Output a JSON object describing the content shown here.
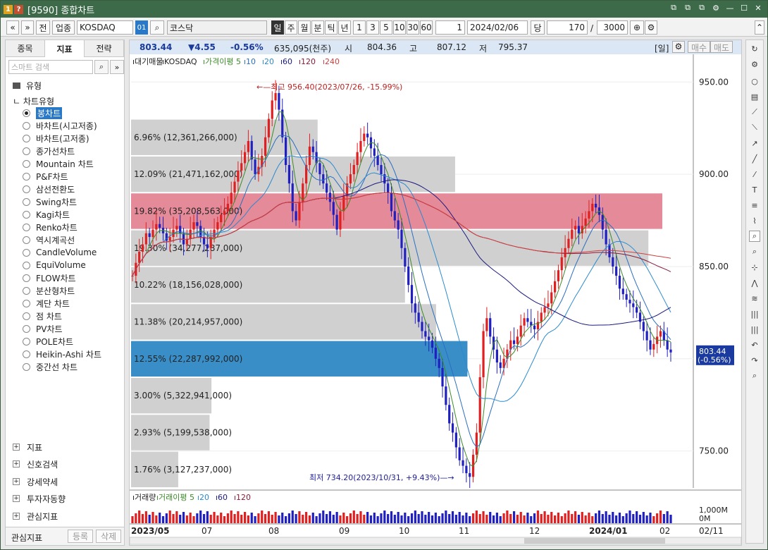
{
  "window": {
    "code_badge": "1",
    "help_badge": "?",
    "title": "[9590] 종합차트",
    "controls": [
      "⧉",
      "⧉",
      "⧉",
      "⚙",
      "—",
      "☐",
      "✕"
    ]
  },
  "toolbar": {
    "nav_prev": "«",
    "nav_menu": "»",
    "btn_prev_item": "전",
    "btn_sector": "업종",
    "code": "KOSDAQ",
    "code_badge": "01",
    "name": "코스닥",
    "period_buttons": [
      "일",
      "주",
      "월",
      "분",
      "틱",
      "년"
    ],
    "active_period": "일",
    "interval_buttons": [
      "1",
      "3",
      "5",
      "10",
      "30",
      "60"
    ],
    "interval_value": "1",
    "date": "2024/02/06",
    "date_btn": "당",
    "count": "170",
    "count_sep": "/",
    "max": "3000"
  },
  "left": {
    "tabs": [
      "종목",
      "지표",
      "전략"
    ],
    "active_tab": "지표",
    "search_placeholder": "스마트 검색",
    "category": "유형",
    "tree_root": "차트유형",
    "chart_types": [
      "봉차트",
      "바차트(시고저종)",
      "바차트(고저종)",
      "종가선차트",
      "Mountain 차트",
      "P&F차트",
      "삼선전환도",
      "Swing차트",
      "Kagi차트",
      "Renko차트",
      "역시계곡선",
      "CandleVolume",
      "EquiVolume",
      "FLOW차트",
      "분산형차트",
      "계단 차트",
      "점 차트",
      "PV차트",
      "POLE차트",
      "Heikin-Ashi 차트",
      "중간선 차트"
    ],
    "selected_type": "봉차트",
    "sections": [
      "지표",
      "신호검색",
      "강세약세",
      "투자자동향",
      "관심지표"
    ],
    "footer_label": "관심지표",
    "footer_register": "등록",
    "footer_delete": "삭제"
  },
  "infobar": {
    "price": "803.44",
    "change": "▼4.55",
    "pct": "-0.56%",
    "volume": "635,095(천주)",
    "open_lbl": "시",
    "open": "804.36",
    "high_lbl": "고",
    "high": "807.12",
    "low_lbl": "저",
    "low": "795.37",
    "period": "[일]",
    "buy": "매수",
    "sell": "매도"
  },
  "legend": {
    "items": [
      {
        "text": "대기매물",
        "color": "#222222"
      },
      {
        "text": "KOSDAQ",
        "color": "#222222"
      },
      {
        "text": "가격이평 5",
        "color": "#3d8a2a"
      },
      {
        "text": "10",
        "color": "#2a6fc0"
      },
      {
        "text": "20",
        "color": "#2a8ad0"
      },
      {
        "text": "60",
        "color": "#1a1a80"
      },
      {
        "text": "120",
        "color": "#8a1a3a"
      },
      {
        "text": "240",
        "color": "#d04040"
      }
    ]
  },
  "volume_legend": {
    "items": [
      {
        "text": "거래량",
        "color": "#222222"
      },
      {
        "text": "거래이평 5",
        "color": "#3d8a2a"
      },
      {
        "text": "20",
        "color": "#2a8ad0"
      },
      {
        "text": "60",
        "color": "#1a1a80"
      },
      {
        "text": "120",
        "color": "#8a1a3a"
      }
    ]
  },
  "annotations": {
    "high": "최고 956.40(2023/07/26, -15.99%)",
    "low": "최저 734.20(2023/10/31, +9.43%)"
  },
  "price_badge": {
    "price": "803.44",
    "pct": "(-0.56%)"
  },
  "axis_right": {
    "ticks": [
      "950.00",
      "900.00",
      "850.00",
      "800.00",
      "750.00"
    ],
    "vol_ticks": [
      "1,000M",
      "0M"
    ]
  },
  "axis_bottom": {
    "labels": [
      "2023/05",
      "07",
      "08",
      "09",
      "10",
      "11",
      "12",
      "2024/01",
      "02",
      "02/11"
    ]
  },
  "chart_data": {
    "type": "candlestick",
    "symbol": "KOSDAQ",
    "period": "daily",
    "ylim": [
      730,
      965
    ],
    "y_ticks": [
      750,
      800,
      850,
      900,
      950
    ],
    "volume_profile": [
      {
        "label": "6.96% (12,361,266,000)",
        "low": 910,
        "high": 930,
        "pct": 6.96,
        "color": "#d0d0d0"
      },
      {
        "label": "12.09% (21,471,162,000)",
        "low": 890,
        "high": 910,
        "pct": 12.09,
        "color": "#d0d0d0"
      },
      {
        "label": "19.82% (35,208,563,000)",
        "low": 870,
        "high": 890,
        "pct": 19.82,
        "color": "#e48a98"
      },
      {
        "label": "19.30% (34,277,287,000)",
        "low": 850,
        "high": 870,
        "pct": 19.3,
        "color": "#d0d0d0"
      },
      {
        "label": "10.22% (18,156,028,000)",
        "low": 830,
        "high": 850,
        "pct": 10.22,
        "color": "#d0d0d0"
      },
      {
        "label": "11.38% (20,214,957,000)",
        "low": 810,
        "high": 830,
        "pct": 11.38,
        "color": "#d0d0d0"
      },
      {
        "label": "12.55% (22,287,992,000)",
        "low": 790,
        "high": 810,
        "pct": 12.55,
        "color": "#3a8ec8"
      },
      {
        "label": "3.00% (5,322,941,000)",
        "low": 770,
        "high": 790,
        "pct": 3.0,
        "color": "#d0d0d0"
      },
      {
        "label": "2.93% (5,199,538,000)",
        "low": 750,
        "high": 770,
        "pct": 2.93,
        "color": "#d0d0d0"
      },
      {
        "label": "1.76% (3,127,237,000)",
        "low": 730,
        "high": 750,
        "pct": 1.76,
        "color": "#d0d0d0"
      }
    ],
    "close_path": [
      845,
      852,
      858,
      862,
      868,
      866,
      870,
      873,
      871,
      868,
      864,
      866,
      870,
      872,
      868,
      862,
      865,
      870,
      874,
      872,
      866,
      862,
      860,
      866,
      870,
      874,
      878,
      880,
      884,
      890,
      896,
      902,
      906,
      912,
      918,
      908,
      900,
      904,
      910,
      920,
      930,
      940,
      944,
      935,
      920,
      905,
      895,
      880,
      875,
      885,
      895,
      905,
      915,
      912,
      906,
      900,
      895,
      890,
      885,
      878,
      870,
      880,
      888,
      895,
      900,
      905,
      912,
      918,
      922,
      920,
      914,
      910,
      905,
      900,
      895,
      890,
      880,
      875,
      870,
      860,
      850,
      840,
      830,
      825,
      820,
      815,
      812,
      810,
      806,
      800,
      795,
      785,
      775,
      765,
      760,
      752,
      745,
      742,
      738,
      736,
      748,
      760,
      790,
      815,
      822,
      812,
      805,
      798,
      795,
      800,
      805,
      810,
      808,
      812,
      818,
      822,
      820,
      818,
      816,
      820,
      825,
      828,
      830,
      836,
      842,
      848,
      855,
      860,
      865,
      870,
      872,
      868,
      872,
      876,
      880,
      884,
      882,
      878,
      870,
      862,
      855,
      850,
      845,
      838,
      835,
      832,
      830,
      828,
      825,
      820,
      815,
      810,
      805,
      808,
      812,
      815,
      810,
      805,
      803.44
    ],
    "ma_note": "moving averages 5/10/20/60/120/240"
  }
}
